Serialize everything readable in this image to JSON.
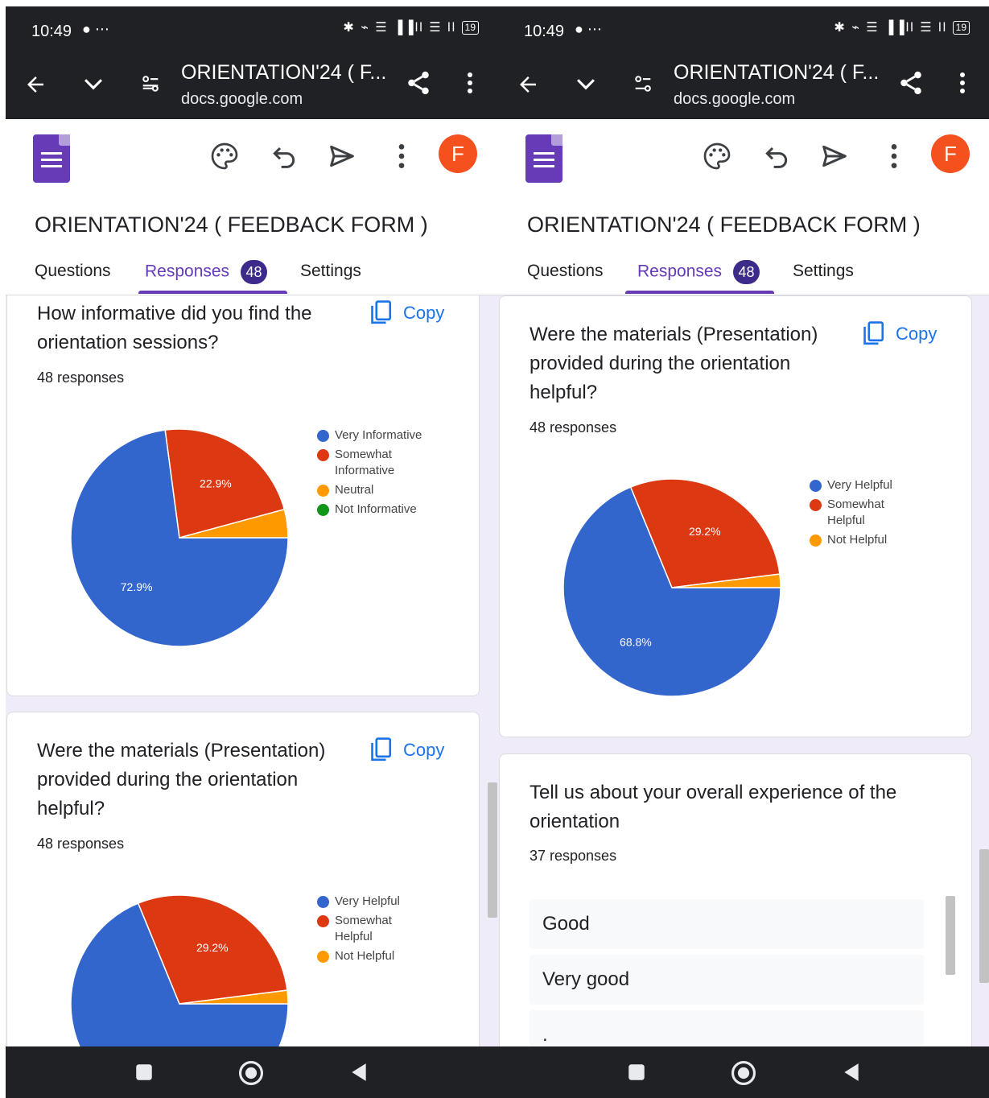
{
  "status_bar": {
    "time": "10:49",
    "misc": "● ⋯",
    "icons": "✱ ⌁ ☰ ▐▐ll ☰ ll",
    "battery": "19"
  },
  "browser": {
    "page_title": "ORIENTATION'24 ( F...",
    "domain": "docs.google.com"
  },
  "app_bar": {
    "avatar_letter": "F"
  },
  "form": {
    "title": "ORIENTATION'24 ( FEEDBACK FORM )"
  },
  "tabs": {
    "questions": "Questions",
    "responses": "Responses",
    "responses_count": "48",
    "settings": "Settings"
  },
  "copy_label": "Copy",
  "questions": {
    "informative": {
      "text": "How informative did you find the orientation sessions?",
      "count": "48 responses",
      "legend": [
        "Very Informative",
        "Somewhat Informative",
        "Neutral",
        "Not Informative"
      ]
    },
    "materials": {
      "text": "Were the materials (Presentation) provided during the orientation helpful?",
      "count": "48 responses",
      "legend": [
        "Very Helpful",
        "Somewhat Helpful",
        "Not Helpful"
      ]
    },
    "experience": {
      "text": "Tell us about your overall experience of the orientation",
      "count": "37 responses",
      "answers": [
        "Good",
        "Very good",
        "."
      ]
    }
  },
  "colors": {
    "blue": "#3366cc",
    "red": "#dc3912",
    "orange": "#ff9900",
    "green": "#109618",
    "accent": "#673ab7"
  },
  "chart_data": [
    {
      "type": "pie",
      "categories": [
        "Very Informative",
        "Somewhat Informative",
        "Neutral",
        "Not Informative"
      ],
      "values": [
        72.9,
        22.9,
        4.2,
        0
      ],
      "labels": [
        "72.9%",
        "22.9%",
        "",
        ""
      ],
      "legend_position": "right"
    },
    {
      "type": "pie",
      "categories": [
        "Very Helpful",
        "Somewhat Helpful",
        "Not Helpful"
      ],
      "values": [
        68.8,
        29.2,
        2.0
      ],
      "labels": [
        "68.8%",
        "29.2%",
        ""
      ],
      "legend_position": "right"
    }
  ]
}
